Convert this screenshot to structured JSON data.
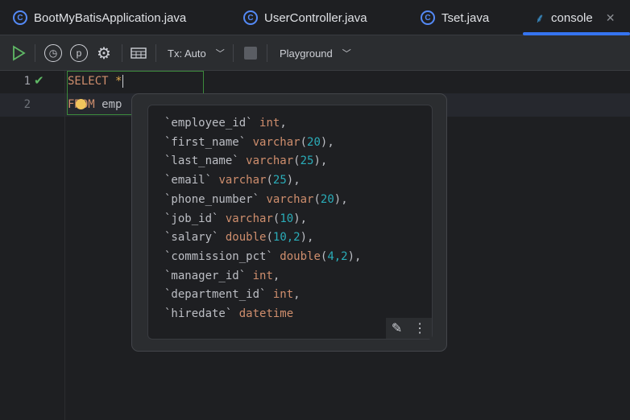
{
  "tabs": [
    {
      "label": "BootMyBatisApplication.java",
      "icon": "spring-boot-class-icon"
    },
    {
      "label": "UserController.java",
      "icon": "class-icon"
    },
    {
      "label": "Tset.java",
      "icon": "runnable-class-icon"
    },
    {
      "label": "console",
      "icon": "mysql-dolphin-icon",
      "active": true,
      "close": "✕"
    }
  ],
  "toolbar": {
    "tx_label": "Tx: Auto",
    "schema_label": "Playground"
  },
  "editor": {
    "line_numbers": [
      "1",
      "2"
    ],
    "line1": {
      "keyword": "SELECT",
      "star": "*"
    },
    "line2": {
      "keyword": "FROM",
      "text": "emp"
    }
  },
  "ddl": [
    {
      "name": "`employee_id`",
      "type": "int",
      "open": "",
      "args": "",
      "close": ",",
      "comma": ""
    },
    {
      "name": "`first_name`",
      "type": "varchar",
      "open": "(",
      "args": "20",
      "close": "),"
    },
    {
      "name": "`last_name`",
      "type": "varchar",
      "open": "(",
      "args": "25",
      "close": "),"
    },
    {
      "name": "`email`",
      "type": "varchar",
      "open": "(",
      "args": "25",
      "close": "),"
    },
    {
      "name": "`phone_number`",
      "type": "varchar",
      "open": "(",
      "args": "20",
      "close": "),"
    },
    {
      "name": "`job_id`",
      "type": "varchar",
      "open": "(",
      "args": "10",
      "close": "),"
    },
    {
      "name": "`salary`",
      "type": "double",
      "open": "(",
      "args": "10,2",
      "close": "),"
    },
    {
      "name": "`commission_pct`",
      "type": "double",
      "open": "(",
      "args": "4,2",
      "close": "),"
    },
    {
      "name": "`manager_id`",
      "type": "int",
      "open": "",
      "args": "",
      "close": ","
    },
    {
      "name": "`department_id`",
      "type": "int",
      "open": "",
      "args": "",
      "close": ","
    },
    {
      "name": "`hiredate`",
      "type": "datetime",
      "open": "",
      "args": "",
      "close": ""
    }
  ],
  "colors": {
    "accent": "#3574f0",
    "keyword": "#cf8e6d",
    "number": "#2aacb8",
    "run": "#5fb865"
  }
}
